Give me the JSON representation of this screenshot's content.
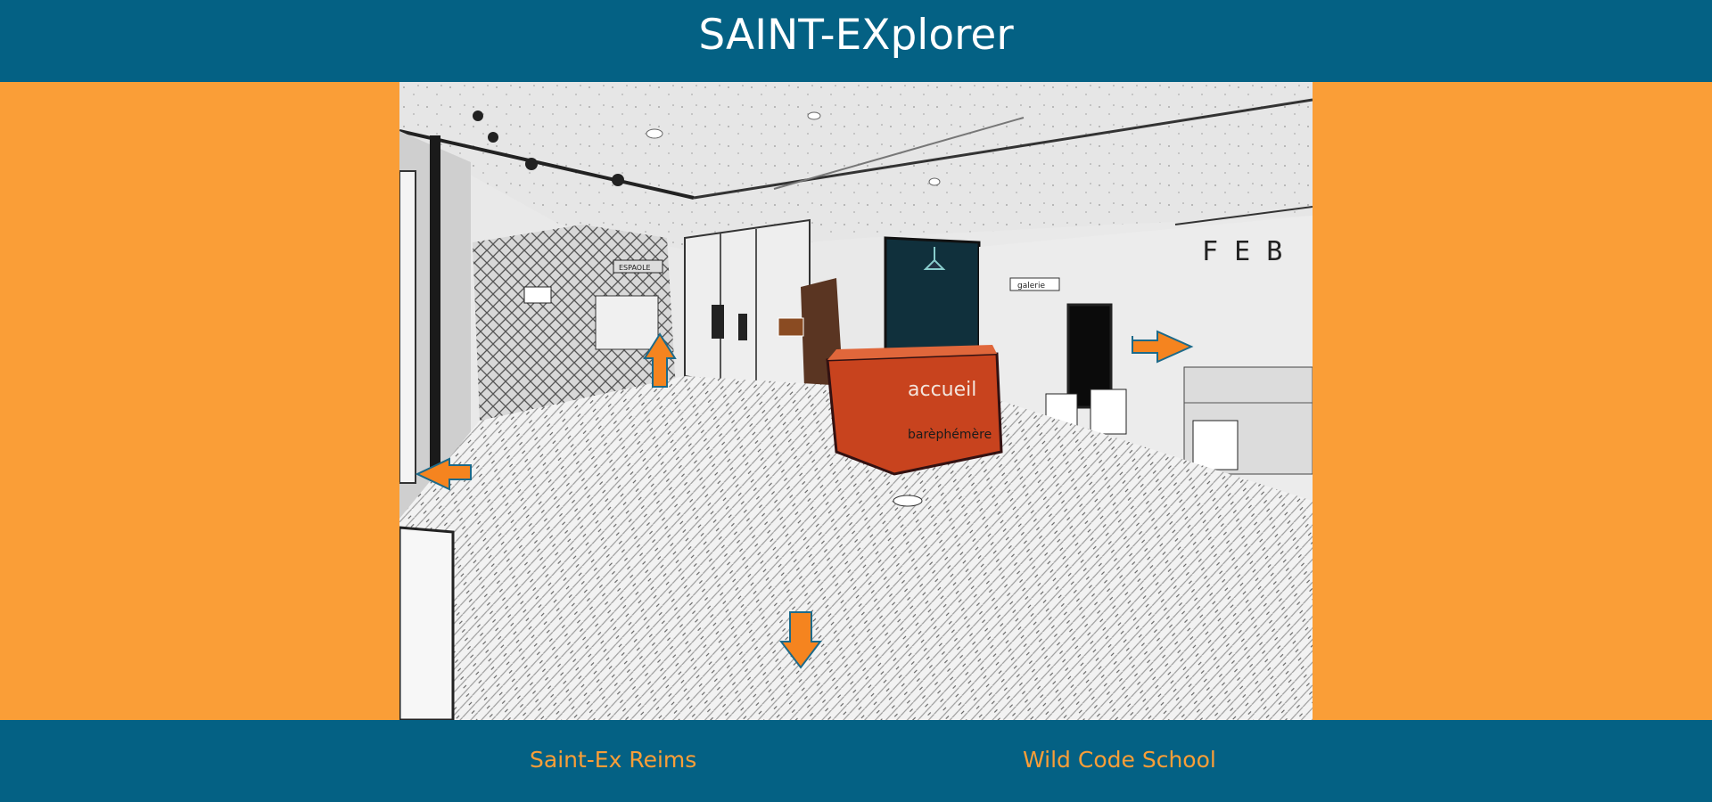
{
  "header": {
    "title": "SAINT-EXplorer"
  },
  "scene": {
    "desk_text": "accueil",
    "desk_subtext": "barèphémère",
    "sign_text": "F E B",
    "small_sign": "galerie",
    "nav_arrows": [
      {
        "direction": "up",
        "icon": "arrow-up-icon"
      },
      {
        "direction": "right",
        "icon": "arrow-right-icon"
      },
      {
        "direction": "left",
        "icon": "arrow-left-icon"
      },
      {
        "direction": "down",
        "icon": "arrow-down-icon"
      }
    ],
    "arrow_color": "#F5841F",
    "desk_color": "#C8431E"
  },
  "footer": {
    "link1": "Saint-Ex Reims",
    "link2": "Wild Code School"
  },
  "colors": {
    "primary": "#046184",
    "accent": "#FA9E37"
  }
}
